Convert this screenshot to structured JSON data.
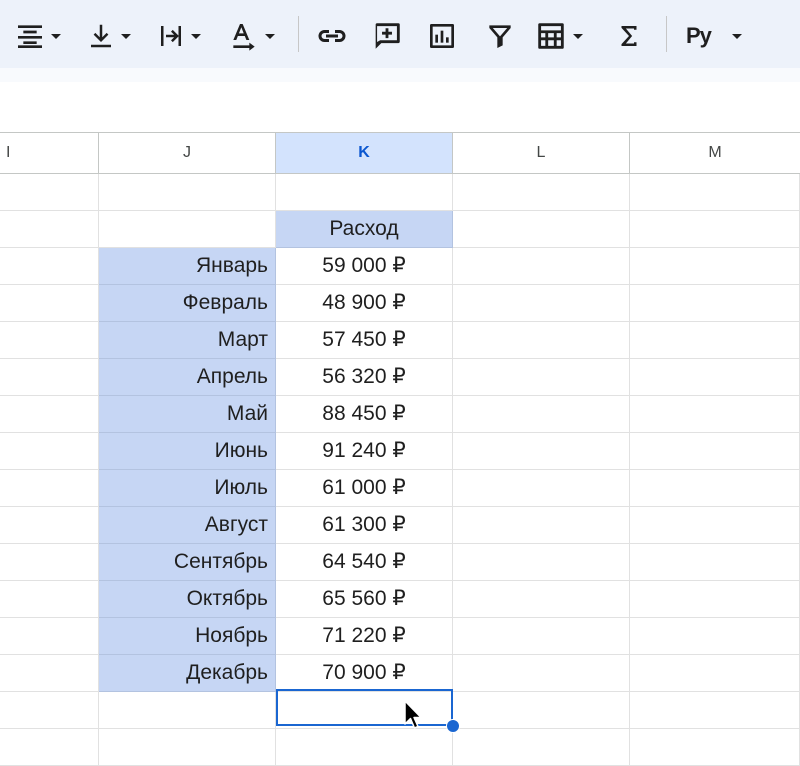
{
  "toolbar": {
    "items": [
      {
        "name": "horizontal-align",
        "icon": "align-center-icon",
        "has_menu": true
      },
      {
        "name": "vertical-align",
        "icon": "align-bottom-icon",
        "has_menu": true
      },
      {
        "name": "text-wrapping",
        "icon": "text-wrap-icon",
        "has_menu": true
      },
      {
        "name": "text-rotation",
        "icon": "text-rotation-icon",
        "has_menu": true
      },
      {
        "name": "insert-link",
        "icon": "link-icon",
        "has_menu": false
      },
      {
        "name": "insert-comment",
        "icon": "add-comment-icon",
        "has_menu": false
      },
      {
        "name": "insert-chart",
        "icon": "chart-icon",
        "has_menu": false
      },
      {
        "name": "create-filter",
        "icon": "filter-icon",
        "has_menu": false
      },
      {
        "name": "filter-views",
        "icon": "table-view-icon",
        "has_menu": true
      },
      {
        "name": "functions",
        "icon": "sigma-icon",
        "has_menu": false
      },
      {
        "name": "input-tools",
        "icon": "input-tools-icon",
        "label": "Pу",
        "has_menu": true
      }
    ]
  },
  "columns": [
    "I",
    "J",
    "K",
    "L",
    "M"
  ],
  "selected_column": "K",
  "table": {
    "header": "Расход",
    "rows": [
      {
        "month": "Январь",
        "amount": "59 000 ₽"
      },
      {
        "month": "Февраль",
        "amount": "48 900 ₽"
      },
      {
        "month": "Март",
        "amount": "57 450 ₽"
      },
      {
        "month": "Апрель",
        "amount": "56 320 ₽"
      },
      {
        "month": "Май",
        "amount": "88 450 ₽"
      },
      {
        "month": "Июнь",
        "amount": "91 240 ₽"
      },
      {
        "month": "Июль",
        "amount": "61 000 ₽"
      },
      {
        "month": "Август",
        "amount": "61 300 ₽"
      },
      {
        "month": "Сентябрь",
        "amount": "64 540 ₽"
      },
      {
        "month": "Октябрь",
        "amount": "65 560 ₽"
      },
      {
        "month": "Ноябрь",
        "amount": "71 220 ₽"
      },
      {
        "month": "Декабрь",
        "amount": "70 900 ₽"
      }
    ]
  },
  "colors": {
    "toolbar_bg": "#edf2fa",
    "selected_header_bg": "#d3e3fd",
    "range_fill": "#c6d6f4",
    "active_border": "#1a66d1"
  }
}
